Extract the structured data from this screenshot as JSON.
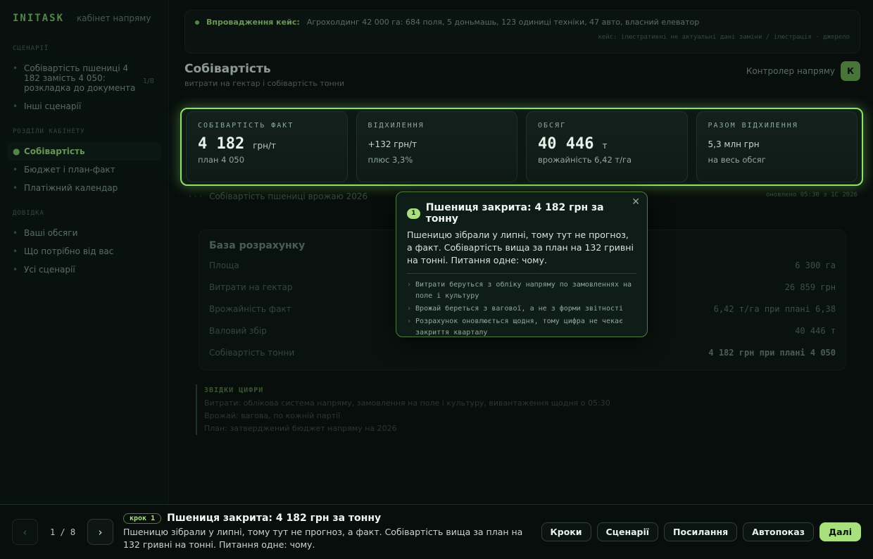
{
  "brand": {
    "logo": "INITASK",
    "subtitle": "кабінет напряму"
  },
  "sidebar": {
    "sections": [
      {
        "heading": "СЦЕНАРІЇ",
        "items": [
          {
            "label": "Собівартість пшениці 4 182 замість 4 050: розкладка до документа",
            "count": "1/8"
          },
          {
            "label": "Інші сценарії"
          }
        ]
      },
      {
        "heading": "РОЗДІЛИ КАБІНЕТУ",
        "items": [
          {
            "label": "Собівартість",
            "active": true
          },
          {
            "label": "Бюджет і план-факт"
          },
          {
            "label": "Платіжний календар"
          }
        ]
      },
      {
        "heading": "ДОВІДКА",
        "items": [
          {
            "label": "Ваші обсяги"
          },
          {
            "label": "Що потрібно від вас"
          },
          {
            "label": "Усі сценарії"
          }
        ]
      }
    ]
  },
  "banner": {
    "key": "Впровадження кейс:",
    "value": "Агрохолдинг 42 000 га: 684 поля, 5 доньмашь, 123 одиниці техніки, 47 авто, власний елеватор",
    "note": "кейс: ілюстративні не актуальні дані заміни / ілюстрація · джерело"
  },
  "page": {
    "title": "Собівартість",
    "subtitle": "витрати на гектар і собівартість тонни",
    "account_label": "Контролер напряму",
    "avatar": "К"
  },
  "kpis": [
    {
      "label": "СОБІВАРТІСТЬ ФАКТ",
      "big": "4 182",
      "unit": "грн/т",
      "sub": "план 4 050"
    },
    {
      "label": "ВІДХИЛЕННЯ",
      "mid": "+132 грн/т",
      "sub": "плюс 3,3%"
    },
    {
      "label": "ОБСЯГ",
      "big": "40 446",
      "unit": "т",
      "sub": "врожайність 6,42 т/га"
    },
    {
      "label": "РАЗОМ ВІДХИЛЕННЯ",
      "mid": "5,3 млн грн",
      "sub": "на весь обсяг"
    }
  ],
  "section_bar": {
    "dots": "· · ·",
    "title": "Собівартість пшениці врожаю 2026",
    "right": "оновлено 05:30 з 1С 2026"
  },
  "calc": {
    "title": "База розрахунку",
    "rows": [
      {
        "label": "Площа",
        "value": "6 300 га"
      },
      {
        "label": "Витрати на гектар",
        "value": "26 859 грн"
      },
      {
        "label": "Врожайність факт",
        "value": "6,42 т/га при плані 6,38"
      },
      {
        "label": "Валовий збір",
        "value": "40 446 т"
      },
      {
        "label": "Собівартість тонни",
        "value": "4 182 грн при плані 4 050",
        "bold": true
      }
    ]
  },
  "sources": {
    "title": "ЗВІДКИ ЦИФРИ",
    "lines": [
      "Витрати: облікова система напряму, замовлення на поле і культуру, вивантаження щодня о 05:30",
      "Врожай: вагова, по кожній партії",
      "План: затверджений бюджет напряму на 2026"
    ]
  },
  "popover": {
    "step": "1",
    "title": "Пшениця закрита: 4 182 грн за тонну",
    "close": "✕",
    "body": "Пшеницю зібрали у липні, тому тут не прогноз, а факт. Собівартість вища за план на 132 гривні на тонні. Питання одне: чому.",
    "bullets": [
      "Витрати беруться з обліку напряму по замовленнях на поле і культуру",
      "Врожай береться з вагової, а не з форми звітності",
      "Розрахунок оновлюється щодня, тому цифра не чекає закриття кварталу"
    ]
  },
  "tour": {
    "prev": "‹",
    "next": "›",
    "counter": "1 / 8",
    "step_pill": "крок 1",
    "title": "Пшениця закрита: 4 182 грн за тонну",
    "desc": "Пшеницю зібрали у липні, тому тут не прогноз, а факт. Собівартість вища за план на 132 гривні на тонні. Питання одне: чому.",
    "actions": {
      "steps": "Кроки",
      "scenarios": "Сценарії",
      "links": "Посилання",
      "autoplay": "Автопоказ",
      "next": "Далі"
    }
  },
  "colors": {
    "accent": "#a8e07e",
    "highlight_border": "#8fe06a",
    "background": "#0a1210"
  }
}
